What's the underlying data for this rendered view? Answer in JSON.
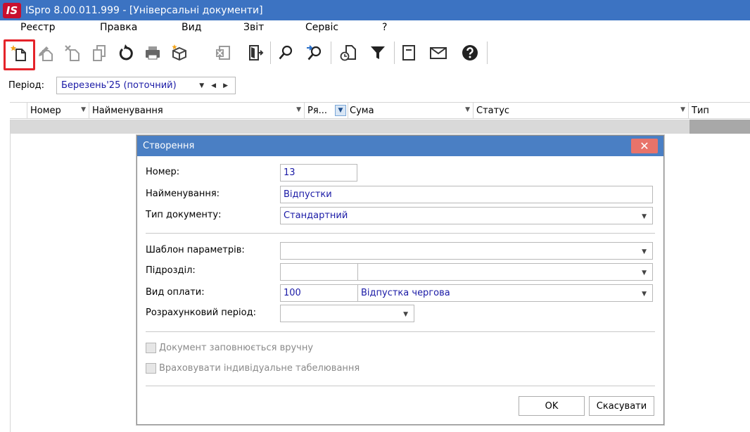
{
  "window": {
    "logo_text": "IS",
    "title": "ISpro 8.00.011.999 - [Універсальні документи]"
  },
  "menu": {
    "items": [
      "Реєстр",
      "Правка",
      "Вид",
      "Звіт",
      "Сервіс",
      "?"
    ]
  },
  "toolbar": {
    "buttons": [
      "new-document-icon",
      "edit-icon",
      "delete-icon",
      "copy-icon",
      "refresh-icon",
      "print-icon",
      "package-icon",
      "excel-icon",
      "exit-icon",
      "search-icon",
      "search-next-icon",
      "document-history-icon",
      "filter-icon",
      "form-icon",
      "mail-icon",
      "help-icon"
    ]
  },
  "period": {
    "label": "Період:",
    "value": "Березень'25 (поточний)"
  },
  "grid": {
    "columns": [
      "Номер",
      "Найменування",
      "Ря...",
      "Сума",
      "Статус",
      "Тип"
    ]
  },
  "dialog": {
    "title": "Створення",
    "close_symbol": "✕",
    "number_label": "Номер:",
    "number_value": "13",
    "name_label": "Найменування:",
    "name_value": "Відпустки",
    "doctype_label": "Тип документу:",
    "doctype_value": "Стандартний",
    "template_label": "Шаблон параметрів:",
    "template_value": "",
    "division_label": "Підрозділ:",
    "division_code": "",
    "division_value": "",
    "paytype_label": "Вид оплати:",
    "paytype_code": "100",
    "paytype_value": "Відпустка чергова",
    "calcperiod_label": "Розрахунковий період:",
    "calcperiod_value": "",
    "manual_fill_label": "Документ заповнюється вручну",
    "individual_timesheet_label": "Враховувати індивідуальне табелювання",
    "ok_label": "OK",
    "cancel_label": "Скасувати"
  },
  "colors": {
    "titlebar": "#3c73c2",
    "dialog_title": "#4a7fc4",
    "close_button": "#e8736a",
    "value_text": "#1a1aa6",
    "highlight": "#e5232a"
  }
}
